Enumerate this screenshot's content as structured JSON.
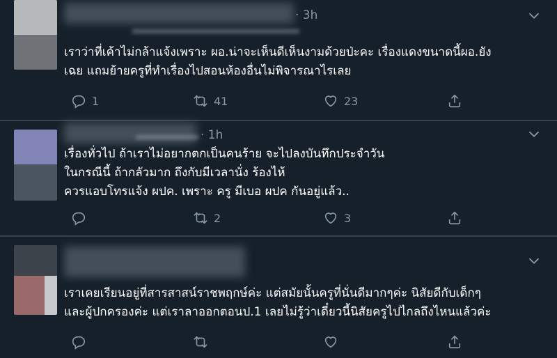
{
  "tweets": [
    {
      "time": "· 3h",
      "text": "เราว่าที่เค้าไม่กล้าแจ้งเพราะ ผอ.น่าจะเห็นดีเห็นงามด้วยป่ะคะ เรื่องแดงขนาดนี้ผอ.ยัง\nเฉย แถมย้ายครูที่ทำเรื่องไปสอนห้องอื่นไม่พิจารณาไรเลย",
      "reply_count": "1",
      "retweet_count": "41",
      "like_count": "23"
    },
    {
      "time": "· 1h",
      "text": "เรื่องทั่วไป ถ้าเราไม่อยากตกเป็นคนร้าย จะไปลงบันทึกประจำวัน\nในกรณีนี้ ถ้ากลัวมาก ถึงกับมีเวลานั่ง ร้องไห้\nควรแอบโทรแจ้ง ผปค. เพราะ ครู มีเบอ ผปค กันอยู่แล้ว..",
      "reply_count": "",
      "retweet_count": "2",
      "like_count": "3"
    },
    {
      "time": "",
      "text": "เราเคยเรียนอยู่ที่สารสาสน์ราชพฤกษ์ค่ะ แต่สมัยนั้นครูที่นั่นดีมากๆค่ะ นิสัยดีกับเด็กๆ\nและผู้ปกครองค่ะ แต่เราลาออกตอนป.1 เลยไม่รู้ว่าเดี๋ยวนี้นิสัยครูไปไกลถึงไหนแล้วค่ะ",
      "reply_count": "",
      "retweet_count": "",
      "like_count": ""
    }
  ],
  "colors": {
    "background": "#15202b",
    "divider": "#38444d",
    "secondary_text": "#8899a6",
    "primary_text": "#ffffff"
  },
  "icons": [
    "chevron-down-icon",
    "reply-icon",
    "retweet-icon",
    "like-icon",
    "share-icon"
  ]
}
